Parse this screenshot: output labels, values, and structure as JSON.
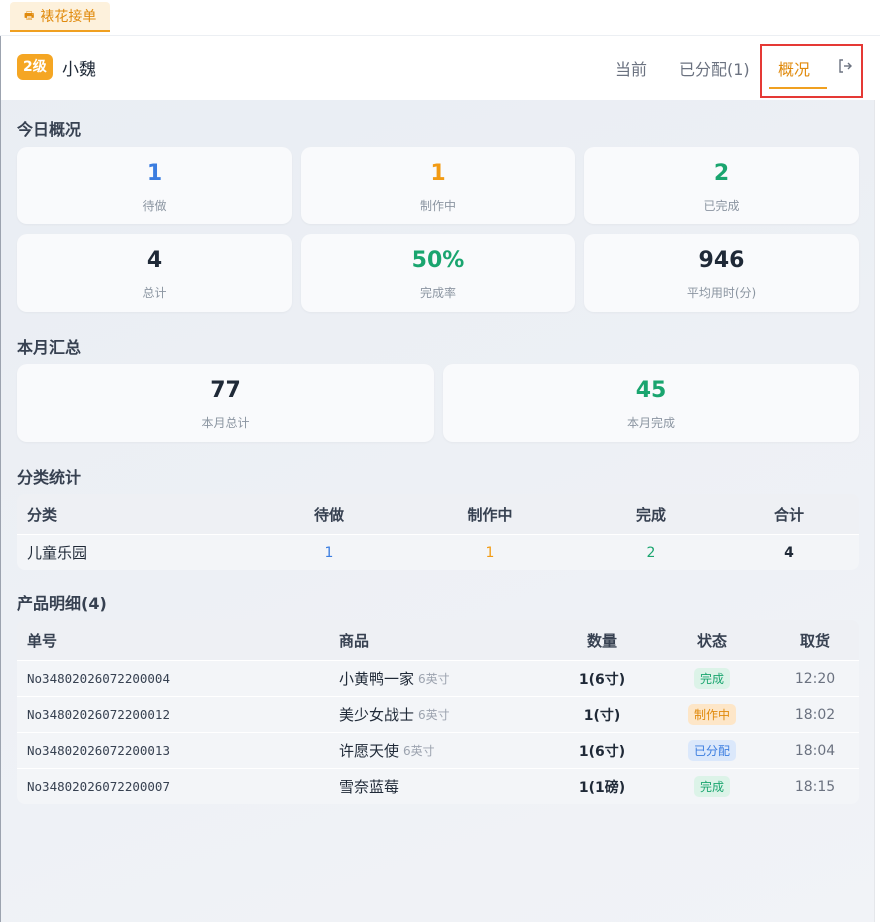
{
  "tab": {
    "icon": "print-icon",
    "label": "裱花接单"
  },
  "header": {
    "level": "2级",
    "user": "小魏",
    "nav": {
      "current": "当前",
      "assigned": "已分配(1)",
      "overview": "概况"
    },
    "logout_icon": "logout-icon"
  },
  "today": {
    "title": "今日概况",
    "cards": [
      {
        "value": "1",
        "label": "待做"
      },
      {
        "value": "1",
        "label": "制作中"
      },
      {
        "value": "2",
        "label": "已完成"
      },
      {
        "value": "4",
        "label": "总计"
      },
      {
        "value": "50%",
        "label": "完成率"
      },
      {
        "value": "946",
        "label": "平均用时(分)"
      }
    ]
  },
  "month": {
    "title": "本月汇总",
    "cards": [
      {
        "value": "77",
        "label": "本月总计"
      },
      {
        "value": "45",
        "label": "本月完成"
      }
    ]
  },
  "category": {
    "title": "分类统计",
    "headers": [
      "分类",
      "待做",
      "制作中",
      "完成",
      "合计"
    ],
    "rows": [
      [
        "儿童乐园",
        "1",
        "1",
        "2",
        "4"
      ]
    ]
  },
  "products": {
    "title": "产品明细(4)",
    "headers": [
      "单号",
      "商品",
      "数量",
      "状态",
      "取货"
    ],
    "rows": [
      {
        "id": "No34802026072200004",
        "name": "小黄鸭一家",
        "size": "6英寸",
        "qty": "1(6寸)",
        "status": "完成",
        "time": "12:20"
      },
      {
        "id": "No34802026072200012",
        "name": "美少女战士",
        "size": "6英寸",
        "qty": "1(寸)",
        "status": "制作中",
        "time": "18:02"
      },
      {
        "id": "No34802026072200013",
        "name": "许愿天使",
        "size": "6英寸",
        "qty": "1(6寸)",
        "status": "已分配",
        "time": "18:04"
      },
      {
        "id": "No34802026072200007",
        "name": "雪奈蓝莓",
        "size": "",
        "qty": "1(1磅)",
        "status": "完成",
        "time": "18:15"
      }
    ]
  },
  "colors": {
    "accent": "#f0a020",
    "blue": "#3b7de0",
    "green": "#1aa56f",
    "highlight": "#e53935"
  }
}
